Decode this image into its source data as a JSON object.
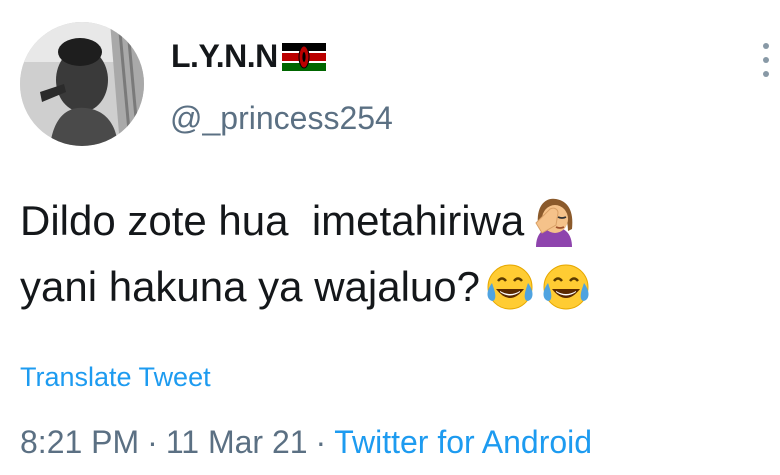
{
  "author": {
    "display_name": "L.Y.N.N",
    "flag_icon": "kenya-flag-icon",
    "handle": "@_princess254",
    "avatar_icon": "profile-photo"
  },
  "menu": {
    "more_icon": "vertical-ellipsis-icon"
  },
  "tweet": {
    "line1_text": "Dildo zote hua  imetahiriwa",
    "line1_emoji": "woman-facepalming-emoji",
    "line2_text": "yani hakuna ya wajaluo?",
    "line2_emojis": [
      "face-with-tears-of-joy-emoji",
      "face-with-tears-of-joy-emoji"
    ]
  },
  "translate": {
    "label": "Translate Tweet"
  },
  "meta": {
    "time": "8:21 PM",
    "separator": "·",
    "date": "11 Mar 21",
    "source": "Twitter for Android"
  },
  "colors": {
    "link": "#1d9bf0",
    "secondary_text": "#5b7083",
    "primary_text": "#14171a"
  }
}
